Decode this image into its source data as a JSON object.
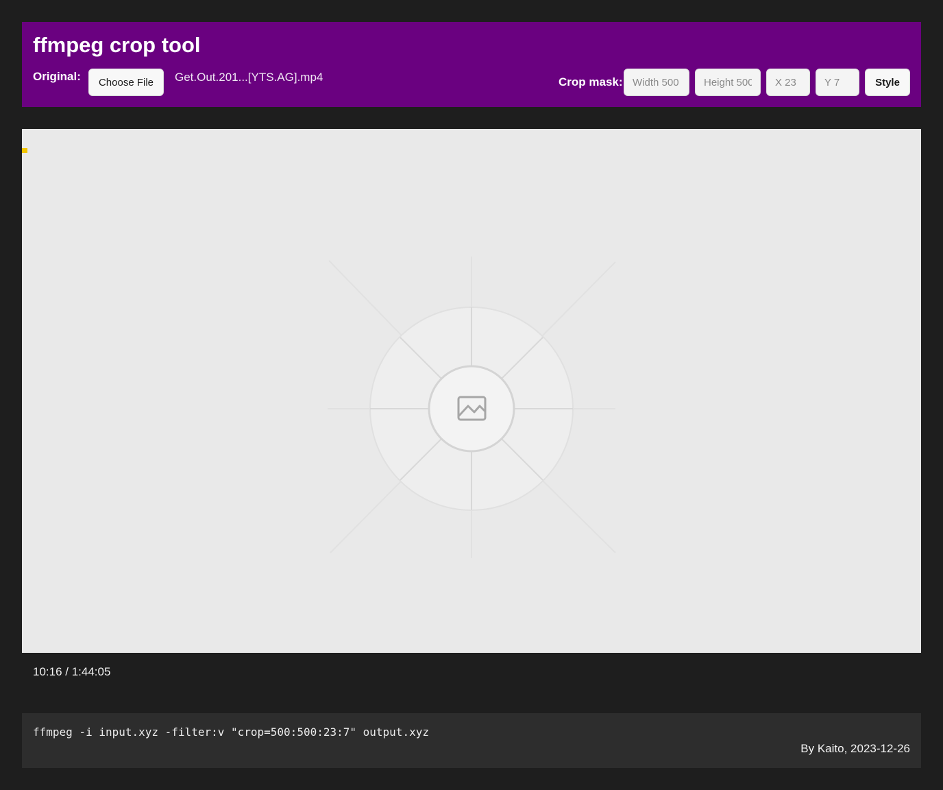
{
  "header": {
    "title": "ffmpeg crop tool",
    "original_label": "Original:",
    "choose_file_label": "Choose File",
    "file_name": "Get.Out.201...[YTS.AG].mp4",
    "crop_mask_label": "Crop mask:",
    "inputs": {
      "width_placeholder": "Width 500",
      "height_placeholder": "Height 500",
      "x_placeholder": "X 23",
      "y_placeholder": "Y 7"
    },
    "style_label": "Style",
    "accent_color": "#6a0180"
  },
  "video": {
    "placeholder_icon": "image-icon",
    "crop_marker_color": "#f2c500"
  },
  "playback": {
    "time": "10:16 / 1:44:05"
  },
  "command": {
    "text": "ffmpeg -i input.xyz -filter:v \"crop=500:500:23:7\" output.xyz"
  },
  "footer": {
    "credit": "By Kaito, 2023-12-26"
  }
}
